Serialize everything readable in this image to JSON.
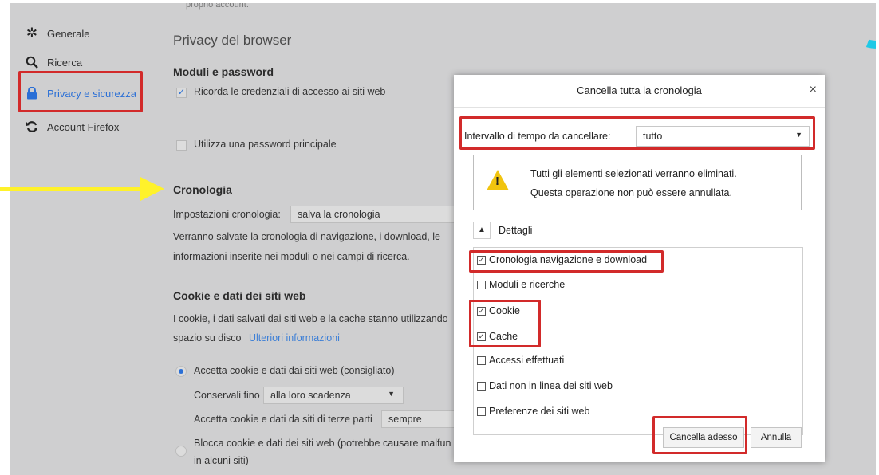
{
  "sidebar": {
    "items": [
      {
        "label": "Generale",
        "icon": "gear-icon"
      },
      {
        "label": "Ricerca",
        "icon": "search-icon"
      },
      {
        "label": "Privacy e sicurezza",
        "icon": "lock-icon"
      },
      {
        "label": "Account Firefox",
        "icon": "sync-icon"
      }
    ]
  },
  "main": {
    "top_partial": "proprio account.",
    "section_title": "Privacy del browser",
    "forms_heading": "Moduli e password",
    "remember_credentials": "Ricorda le credenziali di accesso ai siti web",
    "master_password": "Utilizza una password principale",
    "history_heading": "Cronologia",
    "history_settings_label": "Impostazioni cronologia:",
    "history_settings_value": "salva la cronologia",
    "history_desc_1": "Verranno salvate la cronologia di navigazione, i download, le",
    "history_desc_2": "informazioni inserite nei moduli o nei campi di ricerca.",
    "cookies_heading": "Cookie e dati dei siti web",
    "cookies_desc_1": "I cookie, i dati salvati dai siti web e la cache stanno utilizzando",
    "cookies_desc_2": "spazio su disco",
    "more_info": "Ulteriori informazioni",
    "accept_cookies": "Accetta cookie e dati dai siti web (consigliato)",
    "keep_until_label": "Conservali fino",
    "keep_until_value": "alla loro scadenza",
    "third_party_label": "Accetta cookie e dati da siti di terze parti",
    "third_party_value": "sempre",
    "block_cookies_1": "Blocca cookie e dati dei siti web (potrebbe causare malfun",
    "block_cookies_2": "in alcuni siti)"
  },
  "dialog": {
    "title": "Cancella tutta la cronologia",
    "close": "×",
    "range_label": "Intervallo di tempo da cancellare:",
    "range_value": "tutto",
    "warning_line_1": "Tutti gli elementi selezionati verranno eliminati.",
    "warning_line_2": "Questa operazione non può essere annullata.",
    "details_label": "Dettagli",
    "items": [
      {
        "label": "Cronologia navigazione e download",
        "checked": true
      },
      {
        "label": "Moduli e ricerche",
        "checked": false
      },
      {
        "label": "Cookie",
        "checked": true
      },
      {
        "label": "Cache",
        "checked": true
      },
      {
        "label": "Accessi effettuati",
        "checked": false
      },
      {
        "label": "Dati non in linea dei siti web",
        "checked": false
      },
      {
        "label": "Preferenze dei siti web",
        "checked": false
      }
    ],
    "clear_button": "Cancella adesso",
    "cancel_button": "Annulla"
  },
  "colors": {
    "highlight_red": "#d22a2a",
    "arrow_yellow": "#fff22a",
    "accent_blue": "#2a6fd6",
    "corner_cyan": "#1fc9e6"
  }
}
